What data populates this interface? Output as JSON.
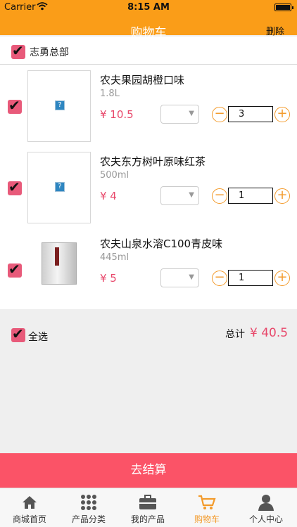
{
  "status_bar": {
    "carrier": "Carrier",
    "time": "8:15 AM"
  },
  "nav": {
    "title": "购物车",
    "delete_label": "删除"
  },
  "store": {
    "name": "志勇总部"
  },
  "items": [
    {
      "name": "农夫果园胡橙口味",
      "spec": "1.8L",
      "price": "¥ 10.5",
      "qty": "3",
      "image": "broken-image-icon"
    },
    {
      "name": "农夫东方树叶原味红茶",
      "spec": "500ml",
      "price": "¥ 4",
      "qty": "1",
      "image": "broken-image-icon"
    },
    {
      "name": "农夫山泉水溶C100青皮味",
      "spec": "445ml",
      "price": "¥ 5",
      "qty": "1",
      "image": "product-box-image"
    }
  ],
  "summary": {
    "select_all": "全选",
    "total_label": "总计",
    "total_value": "¥ 40.5"
  },
  "checkout": {
    "label": "去结算"
  },
  "tabs": [
    {
      "label": "商城首页",
      "icon": "home-icon"
    },
    {
      "label": "产品分类",
      "icon": "grid-icon"
    },
    {
      "label": "我的产品",
      "icon": "briefcase-icon"
    },
    {
      "label": "购物车",
      "icon": "cart-icon",
      "active": true
    },
    {
      "label": "个人中心",
      "icon": "user-icon"
    }
  ],
  "colors": {
    "accent": "#fa9d18",
    "price": "#e8476a",
    "checkout": "#fb5367",
    "checkbox": "#e85a7a"
  }
}
